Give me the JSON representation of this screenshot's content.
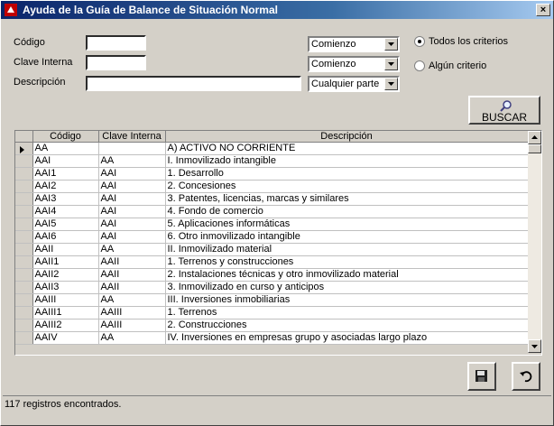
{
  "window": {
    "title": "Ayuda de la Guía de Balance de Situación Normal",
    "close_label": "×"
  },
  "filters": {
    "codigo_label": "Código",
    "clave_label": "Clave Interna",
    "descripcion_label": "Descripción",
    "codigo_value": "",
    "clave_value": "",
    "descripcion_value": "",
    "codigo_mode": "Comienzo",
    "clave_mode": "Comienzo",
    "descripcion_mode": "Cualquier parte",
    "radio_all": "Todos los criterios",
    "radio_any": "Algún criterio"
  },
  "search_button": "BUSCAR",
  "table": {
    "columns": [
      "Código",
      "Clave Interna",
      "Descripción"
    ],
    "rows": [
      [
        "AA",
        "",
        "A) ACTIVO NO CORRIENTE"
      ],
      [
        "AAI",
        "AA",
        "I. Inmovilizado intangible"
      ],
      [
        "AAI1",
        "AAI",
        "1. Desarrollo"
      ],
      [
        "AAI2",
        "AAI",
        "2. Concesiones"
      ],
      [
        "AAI3",
        "AAI",
        "3. Patentes, licencias, marcas y similares"
      ],
      [
        "AAI4",
        "AAI",
        "4. Fondo de comercio"
      ],
      [
        "AAI5",
        "AAI",
        "5. Aplicaciones informáticas"
      ],
      [
        "AAI6",
        "AAI",
        "6. Otro inmovilizado intangible"
      ],
      [
        "AAII",
        "AA",
        "II. Inmovilizado material"
      ],
      [
        "AAII1",
        "AAII",
        "1. Terrenos y construcciones"
      ],
      [
        "AAII2",
        "AAII",
        "2. Instalaciones técnicas y otro inmovilizado material"
      ],
      [
        "AAII3",
        "AAII",
        "3. Inmovilizado en curso y anticipos"
      ],
      [
        "AAIII",
        "AA",
        "III. Inversiones inmobiliarias"
      ],
      [
        "AAIII1",
        "AAIII",
        "1. Terrenos"
      ],
      [
        "AAIII2",
        "AAIII",
        "2. Construcciones"
      ],
      [
        "AAIV",
        "AA",
        "IV. Inversiones en empresas grupo y asociadas largo plazo"
      ]
    ]
  },
  "status": {
    "text": "117 registros encontrados."
  }
}
